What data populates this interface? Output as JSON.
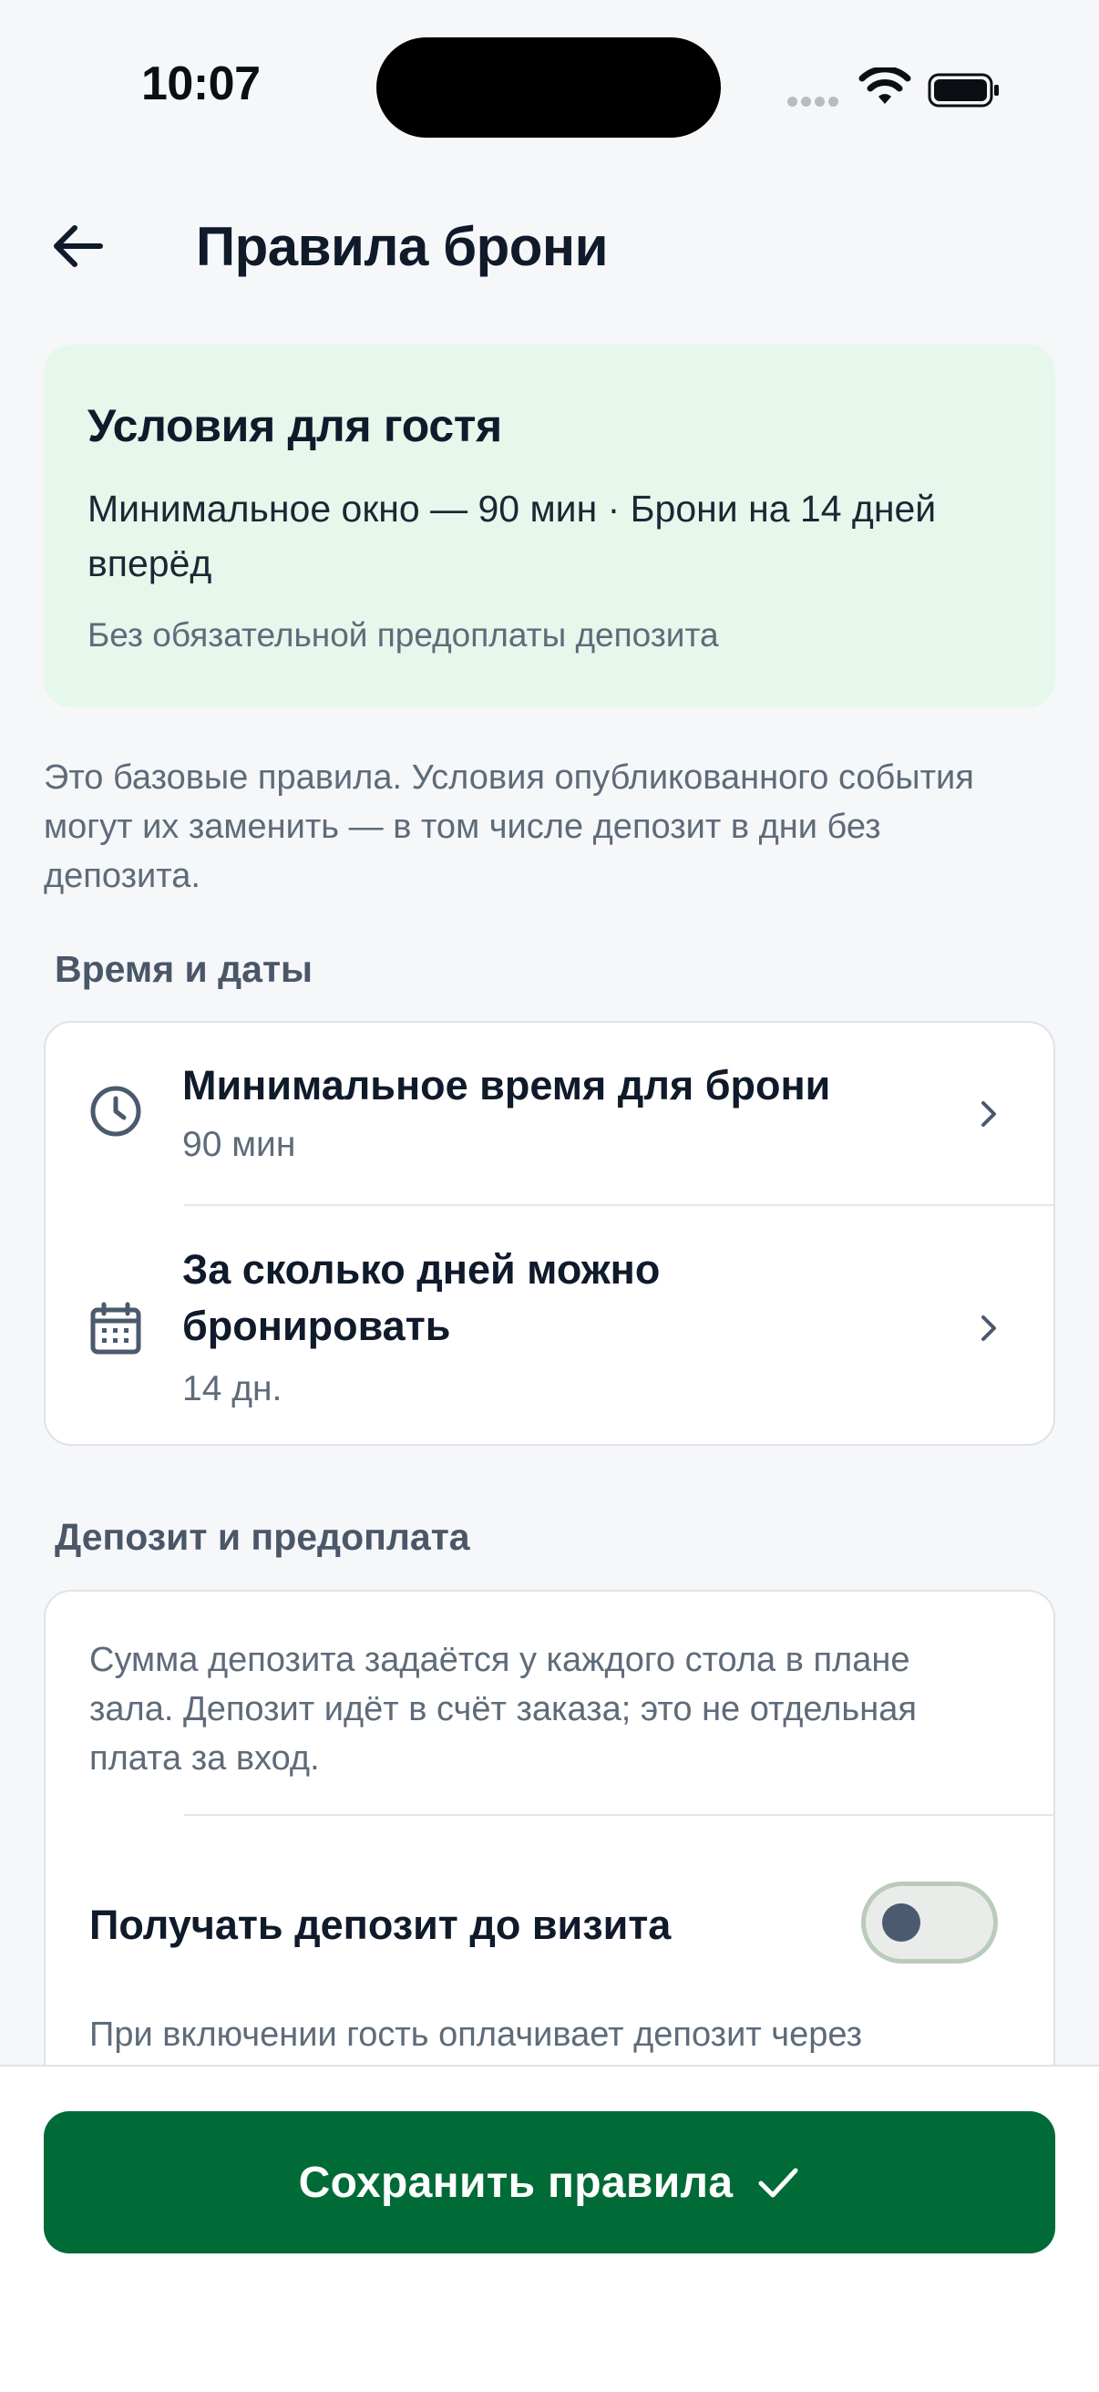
{
  "status_bar": {
    "time": "10:07"
  },
  "header": {
    "title": "Правила брони"
  },
  "summary": {
    "title": "Условия для гостя",
    "main_text": "Минимальное окно — 90 мин · Брони на 14 дней вперёд",
    "note": "Без обязательной предоплаты депозита"
  },
  "info_text": "Это базовые правила. Условия опубликованного события могут их заменить — в том числе депозит в дни без депозита.",
  "time_section": {
    "title": "Время и даты",
    "rows": [
      {
        "title": "Минимальное время для брони",
        "value": "90 мин",
        "icon": "clock-icon"
      },
      {
        "title": "За сколько дней можно бронировать",
        "value": "14 дн.",
        "icon": "calendar-icon"
      }
    ]
  },
  "deposit_section": {
    "title": "Депозит и предоплата",
    "description": "Сумма депозита задаётся у каждого стола в плане зала. Депозит идёт в счёт заказа; это не отдельная плата за вход.",
    "toggle_label": "Получать депозит до визита",
    "toggle_on": false,
    "toggle_hint": "При включении гость оплачивает депозит через"
  },
  "footer": {
    "save_label": "Сохранить правила"
  },
  "colors": {
    "accent": "#006b36",
    "summary_bg": "#e6f7ec",
    "page_bg": "#f6f7f9"
  }
}
